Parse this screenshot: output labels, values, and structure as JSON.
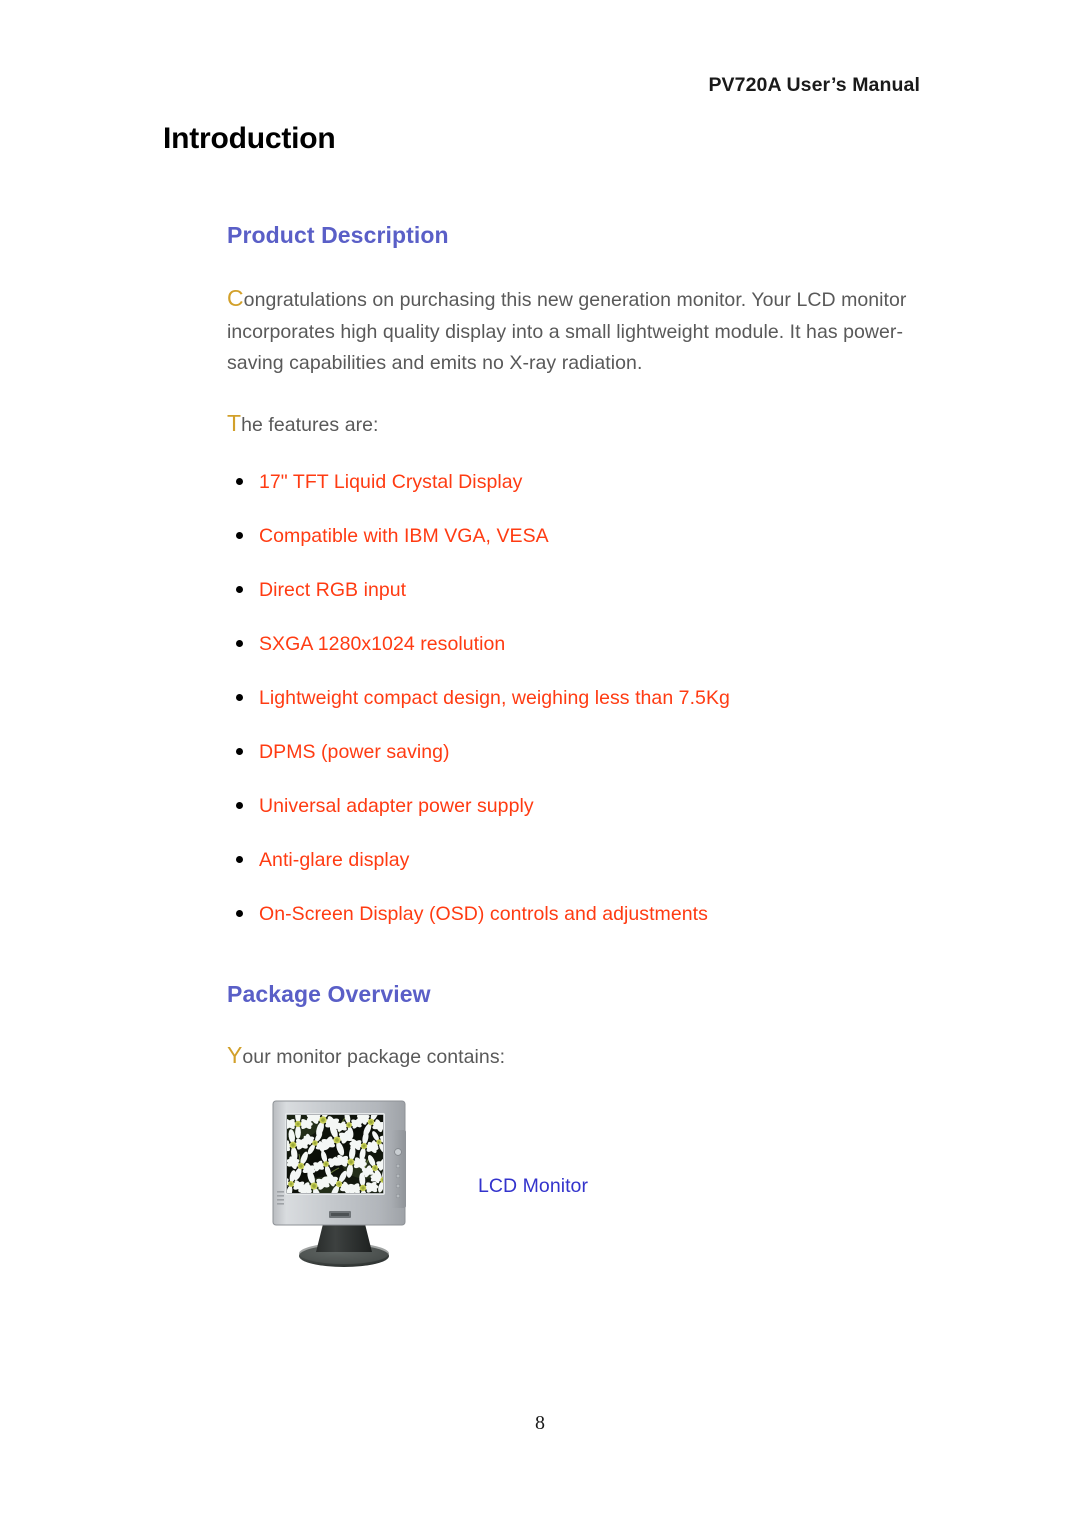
{
  "document": {
    "running_header": "PV720A User’s Manual",
    "chapter_title": "Introduction",
    "page_number": "8"
  },
  "colors": {
    "heading": "#5a5fc7",
    "feature_text": "#ff3b12",
    "body_text": "#595959",
    "dropcap": "#d2a02a",
    "caption": "#3333cc",
    "bullet": "#000000"
  },
  "sections": {
    "product_description": {
      "heading": "Product Description",
      "intro_dropcap": "C",
      "intro_rest": "ongratulations on purchasing this new generation monitor. Your LCD monitor incorporates high quality display into a small lightweight module. It has power- saving capabilities and emits no X-ray radiation.",
      "features_lead_dropcap": "T",
      "features_lead_rest": "he features are:",
      "features": [
        "17\" TFT Liquid Crystal Display",
        "Compatible with IBM VGA, VESA",
        "Direct RGB input",
        "SXGA 1280x1024 resolution",
        "Lightweight compact design, weighing less than 7.5Kg",
        "DPMS (power saving)",
        "Universal adapter power supply",
        "Anti-glare display",
        "On-Screen Display (OSD) controls and adjustments"
      ]
    },
    "package_overview": {
      "heading": "Package Overview",
      "lead_dropcap": "Y",
      "lead_rest": "our monitor package contains:",
      "items": [
        {
          "caption": "LCD Monitor",
          "image": "lcd-monitor-photo"
        }
      ]
    }
  }
}
